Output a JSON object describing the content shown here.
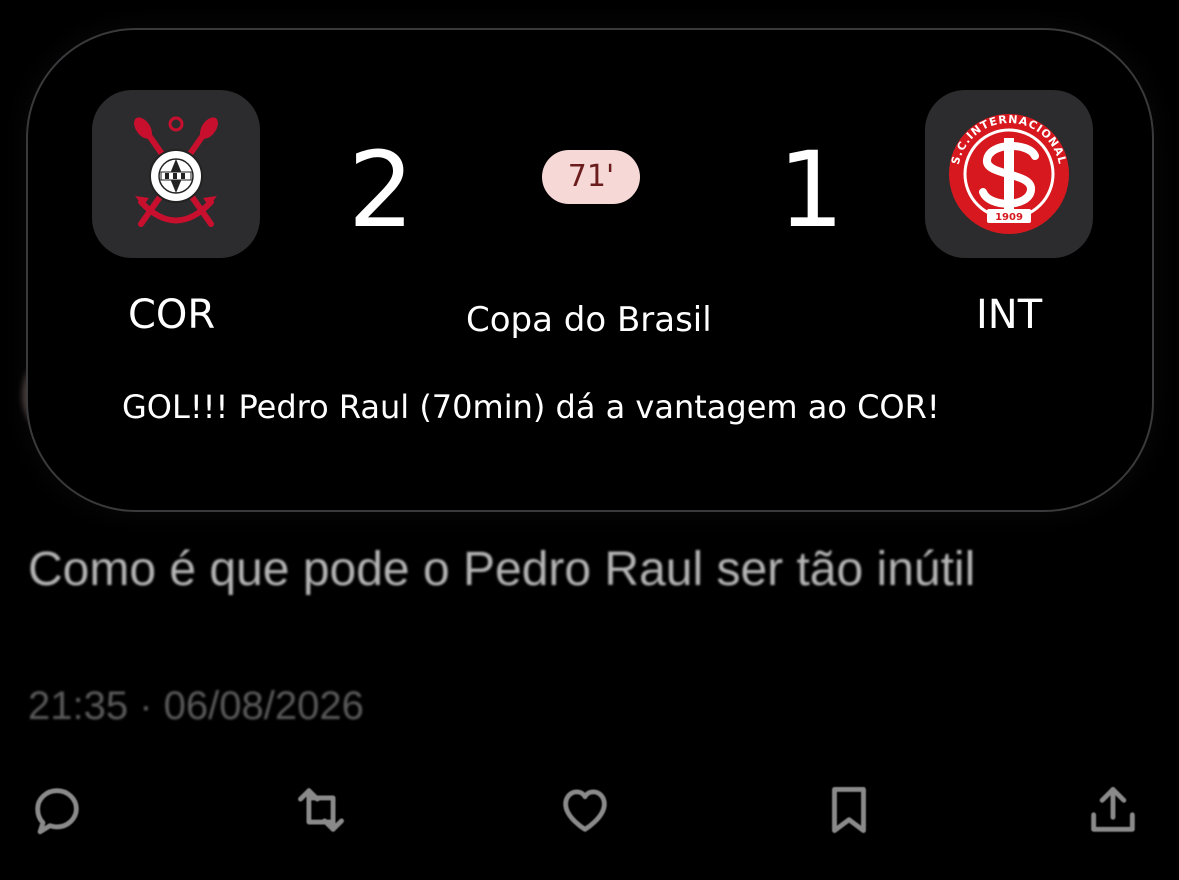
{
  "live_activity": {
    "home": {
      "abbr": "COR",
      "score": "2",
      "logo_icon": "corinthians-crest-icon"
    },
    "away": {
      "abbr": "INT",
      "score": "1",
      "logo_icon": "internacional-crest-icon"
    },
    "minute": "71'",
    "competition": "Copa do Brasil",
    "event": "GOL!!! Pedro Raul (70min) dá a vantagem ao COR!",
    "colors": {
      "minute_badge_bg": "#f6d8d6",
      "minute_badge_text": "#6b1d1d",
      "int_red": "#d7191f",
      "cor_red": "#c8102e"
    },
    "int_logo_ring_text": "S.C.INTERNACIONAL",
    "int_logo_year": "1909"
  },
  "tweet": {
    "text": "Como é que pode o Pedro Raul ser tão inútil",
    "meta": "21:35 · 06/08/2026"
  },
  "actions": [
    {
      "name": "reply",
      "icon": "reply-icon"
    },
    {
      "name": "retweet",
      "icon": "retweet-icon"
    },
    {
      "name": "like",
      "icon": "heart-icon"
    },
    {
      "name": "bookmark",
      "icon": "bookmark-icon"
    },
    {
      "name": "share",
      "icon": "share-icon"
    }
  ]
}
